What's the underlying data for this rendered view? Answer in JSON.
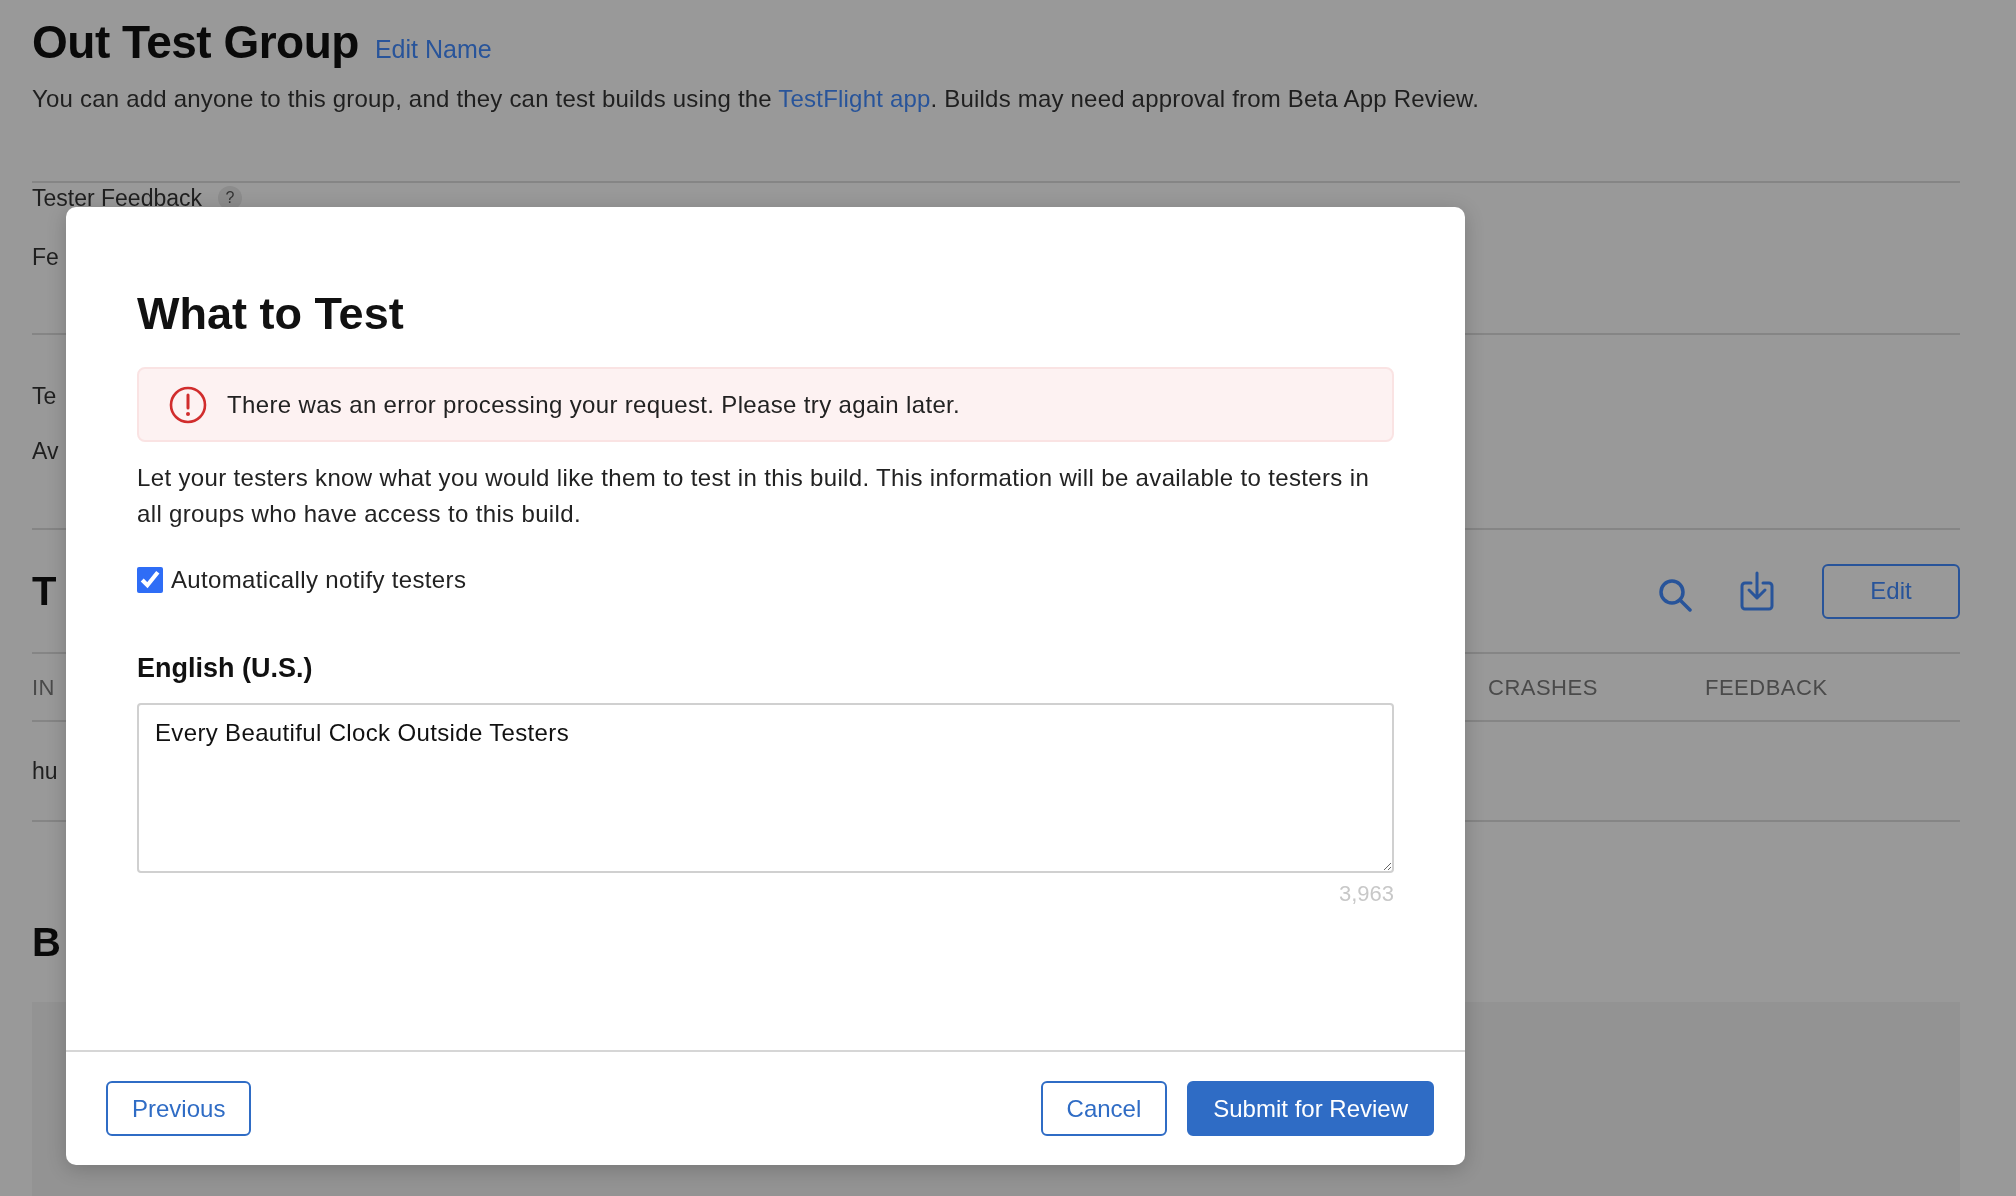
{
  "page": {
    "title": "Out Test Group",
    "edit_link": "Edit Name",
    "description": {
      "before": "You can add anyone to this group, and they can test builds using the ",
      "link": "TestFlight app",
      "after": ". Builds may need approval from Beta App Review."
    }
  },
  "feedback_section": {
    "title": "Tester Feedback",
    "help": "?",
    "text": "Fe"
  },
  "second_section": {
    "title": "Te",
    "text": "Av"
  },
  "testers": {
    "title": "T",
    "edit_button": "Edit",
    "columns": [
      "IN",
      "CRASHES",
      "FEEDBACK"
    ],
    "rows": [
      {
        "link": "hu"
      }
    ]
  },
  "builds": {
    "title": "B"
  },
  "modal": {
    "title": "What to Test",
    "error": "There was an error processing your request. Please try again later.",
    "description": "Let your testers know what you would like them to test in this build. This information will be available to testers in all groups who have access to this build.",
    "notify": {
      "label": "Automatically notify testers",
      "checked": true
    },
    "locale": "English (U.S.)",
    "text_value": "Every Beautiful Clock Outside Testers",
    "counter": "3,963",
    "buttons": [
      {
        "kind": "secondary",
        "label": "Previous"
      },
      {
        "kind": "secondary",
        "label": "Cancel"
      },
      {
        "kind": "primary",
        "label": "Submit for Review"
      }
    ]
  }
}
